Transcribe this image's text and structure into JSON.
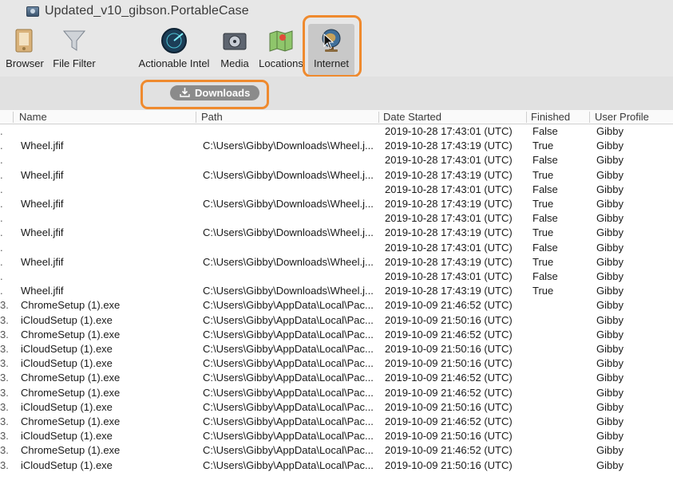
{
  "window": {
    "title": "Updated_v10_gibson.PortableCase"
  },
  "toolbar": {
    "items": [
      {
        "label": "Browser",
        "icon": "browser-icon"
      },
      {
        "label": "File Filter",
        "icon": "funnel-icon"
      },
      {
        "label": "Actionable Intel",
        "icon": "radar-icon"
      },
      {
        "label": "Media",
        "icon": "media-icon"
      },
      {
        "label": "Locations",
        "icon": "map-icon"
      },
      {
        "label": "Internet",
        "icon": "globe-icon",
        "selected": true
      }
    ]
  },
  "subbar": {
    "downloads_label": "Downloads"
  },
  "colors": {
    "highlight": "#ef8a2e",
    "pill": "#8b8b8b"
  },
  "table": {
    "columns": [
      "Name",
      "Path",
      "Date Started",
      "Finished",
      "User Profile"
    ],
    "rows": [
      {
        "lead": ".",
        "name": "",
        "path": "",
        "date": "2019-10-28 17:43:01 (UTC)",
        "finished": "False",
        "user": "Gibby"
      },
      {
        "lead": ".",
        "name": "Wheel.jfif",
        "path": "C:\\Users\\Gibby\\Downloads\\Wheel.j...",
        "date": "2019-10-28 17:43:19 (UTC)",
        "finished": "True",
        "user": "Gibby"
      },
      {
        "lead": ".",
        "name": "",
        "path": "",
        "date": "2019-10-28 17:43:01 (UTC)",
        "finished": "False",
        "user": "Gibby"
      },
      {
        "lead": ".",
        "name": "Wheel.jfif",
        "path": "C:\\Users\\Gibby\\Downloads\\Wheel.j...",
        "date": "2019-10-28 17:43:19 (UTC)",
        "finished": "True",
        "user": "Gibby"
      },
      {
        "lead": ".",
        "name": "",
        "path": "",
        "date": "2019-10-28 17:43:01 (UTC)",
        "finished": "False",
        "user": "Gibby"
      },
      {
        "lead": ".",
        "name": "Wheel.jfif",
        "path": "C:\\Users\\Gibby\\Downloads\\Wheel.j...",
        "date": "2019-10-28 17:43:19 (UTC)",
        "finished": "True",
        "user": "Gibby"
      },
      {
        "lead": ".",
        "name": "",
        "path": "",
        "date": "2019-10-28 17:43:01 (UTC)",
        "finished": "False",
        "user": "Gibby"
      },
      {
        "lead": ".",
        "name": "Wheel.jfif",
        "path": "C:\\Users\\Gibby\\Downloads\\Wheel.j...",
        "date": "2019-10-28 17:43:19 (UTC)",
        "finished": "True",
        "user": "Gibby"
      },
      {
        "lead": ".",
        "name": "",
        "path": "",
        "date": "2019-10-28 17:43:01 (UTC)",
        "finished": "False",
        "user": "Gibby"
      },
      {
        "lead": ".",
        "name": "Wheel.jfif",
        "path": "C:\\Users\\Gibby\\Downloads\\Wheel.j...",
        "date": "2019-10-28 17:43:19 (UTC)",
        "finished": "True",
        "user": "Gibby"
      },
      {
        "lead": ".",
        "name": "",
        "path": "",
        "date": "2019-10-28 17:43:01 (UTC)",
        "finished": "False",
        "user": "Gibby"
      },
      {
        "lead": ".",
        "name": "Wheel.jfif",
        "path": "C:\\Users\\Gibby\\Downloads\\Wheel.j...",
        "date": "2019-10-28 17:43:19 (UTC)",
        "finished": "True",
        "user": "Gibby"
      },
      {
        "lead": "3...",
        "name": "ChromeSetup (1).exe",
        "path": "C:\\Users\\Gibby\\AppData\\Local\\Pac...",
        "date": "2019-10-09 21:46:52 (UTC)",
        "finished": "",
        "user": "Gibby"
      },
      {
        "lead": "3...",
        "name": "iCloudSetup (1).exe",
        "path": "C:\\Users\\Gibby\\AppData\\Local\\Pac...",
        "date": "2019-10-09 21:50:16 (UTC)",
        "finished": "",
        "user": "Gibby"
      },
      {
        "lead": "3...",
        "name": "ChromeSetup (1).exe",
        "path": "C:\\Users\\Gibby\\AppData\\Local\\Pac...",
        "date": "2019-10-09 21:46:52 (UTC)",
        "finished": "",
        "user": "Gibby"
      },
      {
        "lead": "3...",
        "name": "iCloudSetup (1).exe",
        "path": "C:\\Users\\Gibby\\AppData\\Local\\Pac...",
        "date": "2019-10-09 21:50:16 (UTC)",
        "finished": "",
        "user": "Gibby"
      },
      {
        "lead": "3...",
        "name": "iCloudSetup (1).exe",
        "path": "C:\\Users\\Gibby\\AppData\\Local\\Pac...",
        "date": "2019-10-09 21:50:16 (UTC)",
        "finished": "",
        "user": "Gibby"
      },
      {
        "lead": "3...",
        "name": "ChromeSetup (1).exe",
        "path": "C:\\Users\\Gibby\\AppData\\Local\\Pac...",
        "date": "2019-10-09 21:46:52 (UTC)",
        "finished": "",
        "user": "Gibby"
      },
      {
        "lead": "3...",
        "name": "ChromeSetup (1).exe",
        "path": "C:\\Users\\Gibby\\AppData\\Local\\Pac...",
        "date": "2019-10-09 21:46:52 (UTC)",
        "finished": "",
        "user": "Gibby"
      },
      {
        "lead": "3...",
        "name": "iCloudSetup (1).exe",
        "path": "C:\\Users\\Gibby\\AppData\\Local\\Pac...",
        "date": "2019-10-09 21:50:16 (UTC)",
        "finished": "",
        "user": "Gibby"
      },
      {
        "lead": "3...",
        "name": "ChromeSetup (1).exe",
        "path": "C:\\Users\\Gibby\\AppData\\Local\\Pac...",
        "date": "2019-10-09 21:46:52 (UTC)",
        "finished": "",
        "user": "Gibby"
      },
      {
        "lead": "3...",
        "name": "iCloudSetup (1).exe",
        "path": "C:\\Users\\Gibby\\AppData\\Local\\Pac...",
        "date": "2019-10-09 21:50:16 (UTC)",
        "finished": "",
        "user": "Gibby"
      },
      {
        "lead": "3...",
        "name": "ChromeSetup (1).exe",
        "path": "C:\\Users\\Gibby\\AppData\\Local\\Pac...",
        "date": "2019-10-09 21:46:52 (UTC)",
        "finished": "",
        "user": "Gibby"
      },
      {
        "lead": "3...",
        "name": "iCloudSetup (1).exe",
        "path": "C:\\Users\\Gibby\\AppData\\Local\\Pac...",
        "date": "2019-10-09 21:50:16 (UTC)",
        "finished": "",
        "user": "Gibby"
      }
    ]
  }
}
